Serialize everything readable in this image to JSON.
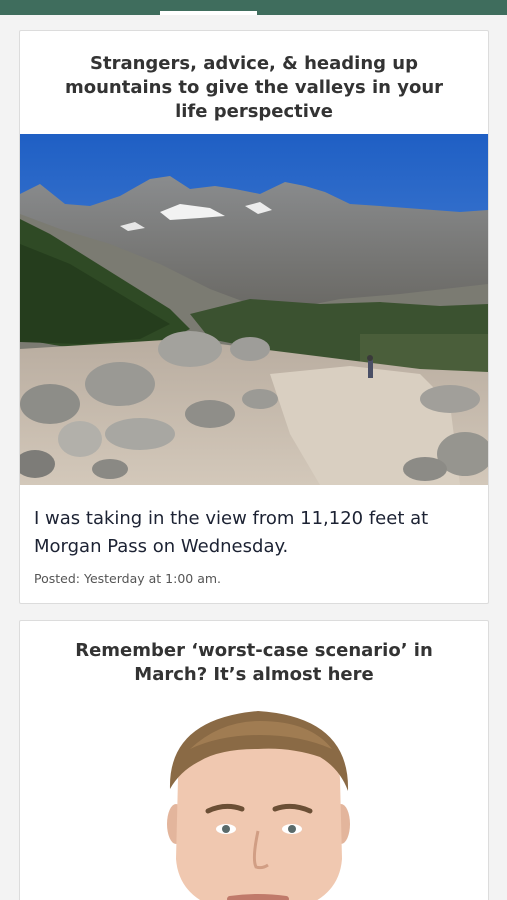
{
  "colors": {
    "topbar": "#3f6d5d",
    "background": "#f3f3f3",
    "card_title": "#333333",
    "caption": "#1c2233"
  },
  "feed": {
    "cards": [
      {
        "title": "Strangers, advice, & heading up mountains to give the valleys in your life perspective",
        "image_alt": "mountain-pass-photo",
        "caption": "I was taking in the view from 11,120 feet at Morgan Pass on Wednesday.",
        "posted": "Posted: Yesterday at 1:00 am."
      },
      {
        "title": "Remember ‘worst-case scenario’ in March? It’s almost here",
        "image_alt": "columnist-portrait"
      }
    ]
  }
}
